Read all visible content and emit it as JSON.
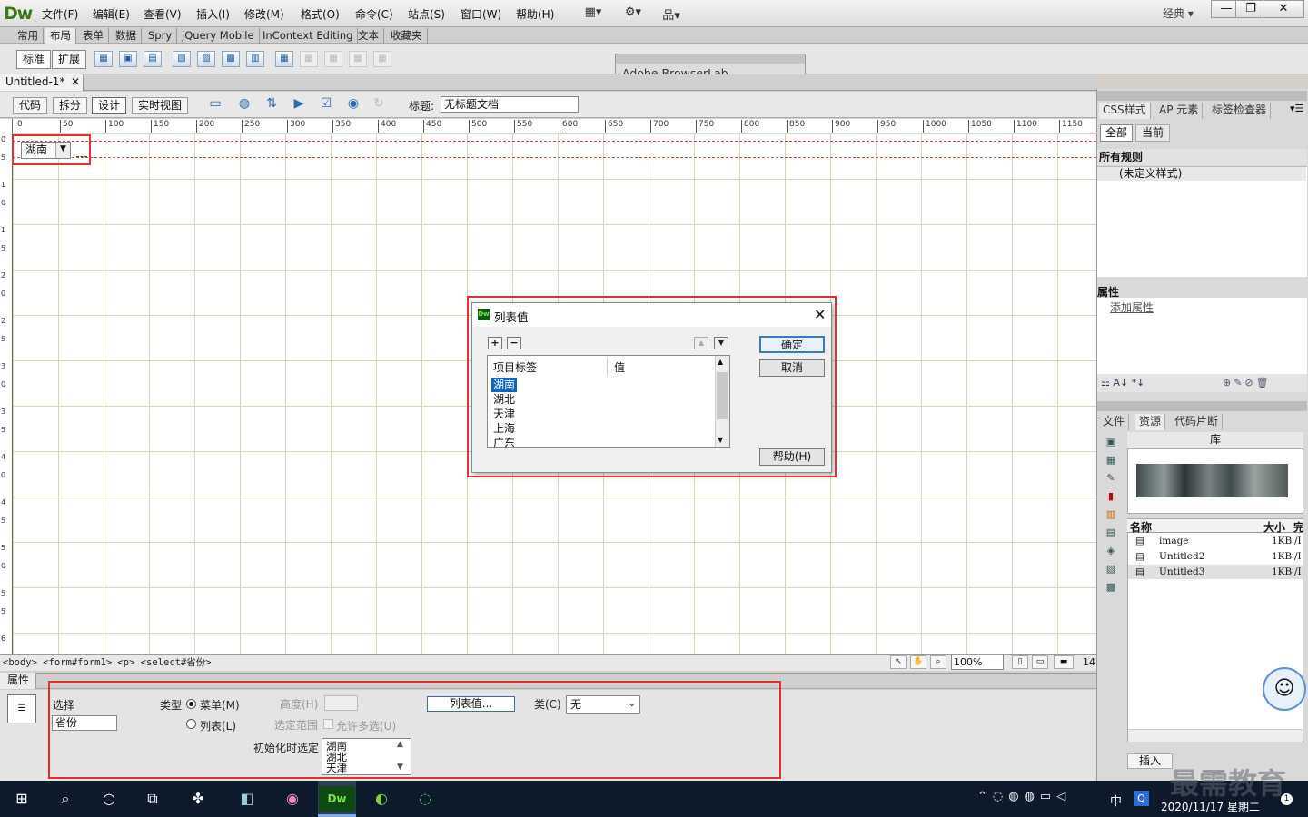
{
  "app": {
    "logo": "Dw",
    "workspace": "经典 ▾"
  },
  "menu": [
    "文件(F)",
    "编辑(E)",
    "查看(V)",
    "插入(I)",
    "修改(M)",
    "格式(O)",
    "命令(C)",
    "站点(S)",
    "窗口(W)",
    "帮助(H)"
  ],
  "insert_tabs": [
    "常用",
    "布局",
    "表单",
    "数据",
    "Spry",
    "jQuery Mobile",
    "InContext Editing",
    "文本",
    "收藏夹"
  ],
  "layout_modes": {
    "standard": "标准",
    "expanded": "扩展"
  },
  "browserlab": "Adobe BrowserLab",
  "doc_tab": "Untitled-1*",
  "view_buttons": {
    "code": "代码",
    "split": "拆分",
    "design": "设计",
    "live": "实时视图"
  },
  "title_label": "标题:",
  "title_value": "无标题文档",
  "ruler_h": [
    "0",
    "50",
    "100",
    "150",
    "200",
    "250",
    "300",
    "350",
    "400",
    "450",
    "500",
    "550",
    "600",
    "650",
    "700",
    "750",
    "800",
    "850",
    "900",
    "950",
    "1000",
    "1050",
    "1100",
    "1150"
  ],
  "ruler_v": [
    "0",
    "5",
    "1",
    "0",
    "1",
    "5",
    "2",
    "0",
    "2",
    "5",
    "3",
    "0",
    "3",
    "5",
    "4",
    "0",
    "4",
    "5",
    "5",
    "0",
    "5",
    "5",
    "6",
    "0",
    "6",
    "5"
  ],
  "canvas_select": "湖南",
  "tag_selector": "<body> <form#form1> <p> <select#省份>",
  "zoom": "100%",
  "window_size": "14",
  "properties": {
    "tab": "属性",
    "kind_label": "选择",
    "name_value": "省份",
    "type_label": "类型",
    "type_menu": "菜单(M)",
    "type_list": "列表(L)",
    "height_label": "高度(H)",
    "range_label": "选定范围",
    "multi_label": "允许多选(U)",
    "list_values_btn": "列表值...",
    "class_label": "类(C)",
    "class_value": "无",
    "init_label": "初始化时选定",
    "init_items": [
      "湖南",
      "湖北",
      "天津"
    ]
  },
  "css_panel": {
    "tabs": [
      "CSS样式",
      "AP 元素",
      "标签检查器"
    ],
    "all": "全部",
    "current": "当前",
    "all_rules": "所有规则",
    "rule0": "(未定义样式)",
    "props": "属性",
    "add_prop": "添加属性"
  },
  "assets_panel": {
    "tabs": [
      "文件",
      "资源",
      "代码片断"
    ],
    "library": "库",
    "col_name": "名称",
    "col_size": "大小",
    "col_path": "完",
    "rows": [
      {
        "name": "image",
        "size": "1KB",
        "path": "/I"
      },
      {
        "name": "Untitled2",
        "size": "1KB",
        "path": "/I"
      },
      {
        "name": "Untitled3",
        "size": "1KB",
        "path": "/I"
      }
    ],
    "insert": "插入"
  },
  "dialog": {
    "title": "列表值",
    "col_label": "项目标签",
    "col_value": "值",
    "items": [
      "湖南",
      "湖北",
      "天津",
      "上海",
      "广东"
    ],
    "ok": "确定",
    "cancel": "取消",
    "help": "帮助(H)"
  },
  "taskbar": {
    "time": "2020/11/17 星期二",
    "ime": "中",
    "notif": "1"
  },
  "watermark": "最需教育"
}
